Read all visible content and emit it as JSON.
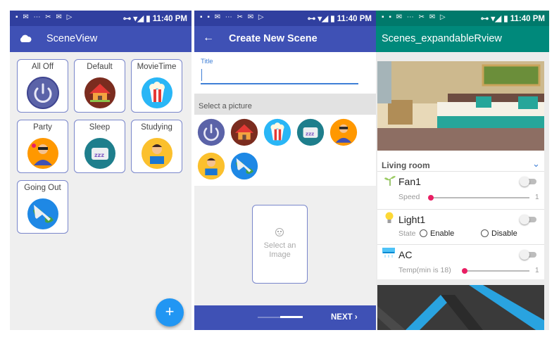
{
  "status_bar": {
    "time": "11:40 PM"
  },
  "scene_view": {
    "title": "SceneView",
    "tiles": [
      {
        "label": "All Off",
        "icon": "power-icon"
      },
      {
        "label": "Default",
        "icon": "house-icon"
      },
      {
        "label": "MovieTime",
        "icon": "popcorn-icon"
      },
      {
        "label": "Party",
        "icon": "party-person-icon"
      },
      {
        "label": "Sleep",
        "icon": "sleep-pillow-icon"
      },
      {
        "label": "Studying",
        "icon": "reading-person-icon"
      },
      {
        "label": "Going Out",
        "icon": "globe-plane-icon"
      }
    ],
    "fab_label": "+"
  },
  "create_scene": {
    "title": "Create New Scene",
    "back_icon": "←",
    "title_field_label": "Title",
    "title_value": "",
    "section_label": "Select a picture",
    "image_placeholder_line1": "Select an",
    "image_placeholder_line2": "Image",
    "next_label": "NEXT ›"
  },
  "expandable": {
    "title": "Scenes_expandableRview",
    "room_name": "Living room",
    "chevron": "⌄",
    "devices": [
      {
        "name": "Fan1",
        "control_label": "Speed",
        "value": "1",
        "icon": "plant-fan-icon"
      },
      {
        "name": "Light1",
        "control_label": "State",
        "option1": "Enable",
        "option2": "Disable",
        "icon": "bulb-icon"
      },
      {
        "name": "AC",
        "control_label": "Temp(min is 18)",
        "value": "1",
        "icon": "ac-icon"
      }
    ]
  },
  "colors": {
    "indigo": "#3f51b5",
    "teal": "#00897b",
    "fab": "#2196f3",
    "accent": "#e91e63"
  }
}
